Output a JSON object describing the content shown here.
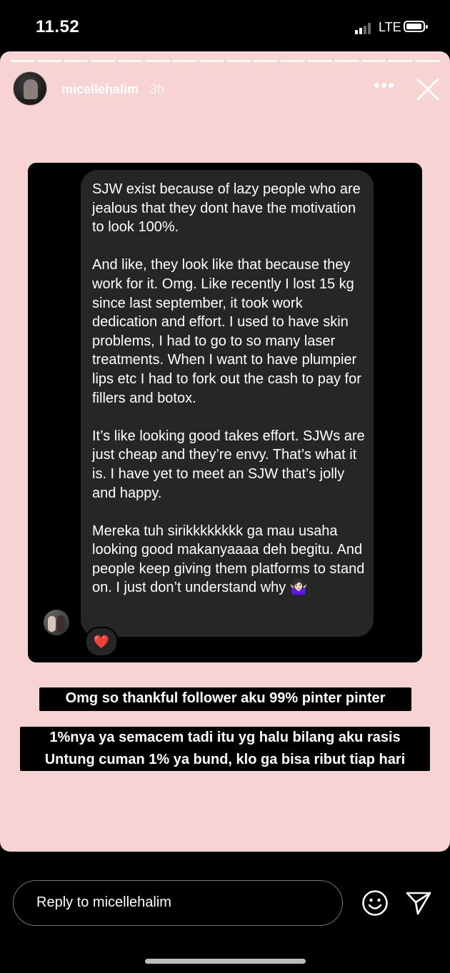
{
  "status_bar": {
    "time": "11.52",
    "network": "LTE"
  },
  "story": {
    "background_color": "#f7d3d4",
    "segments": 16,
    "username": "micellehalim",
    "time_ago": "3h",
    "more_icon": "ellipsis-icon",
    "close_icon": "close-icon"
  },
  "dm_screenshot": {
    "message": "SJW exist because of lazy people who are jealous that they dont have the motivation to look 100%.\n\nAnd like, they look like that because they work for it. Omg. Like recently I lost 15 kg since last september, it took work dedication and effort. I used to have skin problems, I had to go to so many laser treatments. When I want to have plumpier lips etc I had to fork out the cash to pay for fillers and botox.\n\nIt’s like looking good takes effort. SJWs are just cheap and they’re envy. That’s what it is. I have yet to meet an SJW that’s jolly and happy.\n\nMereka tuh sirikkkkkkkk ga mau usaha looking good makanyaaaa deh begitu. And people keep giving them platforms to stand on. I just don’t understand why 🤷🏻‍♀️",
    "reaction": "❤️"
  },
  "captions": [
    "Omg so thankful follower aku 99% pinter pinter",
    "1%nya ya semacem tadi itu yg halu bilang aku rasis\nUntung cuman 1% ya bund, klo ga bisa ribut tiap hari"
  ],
  "reply": {
    "placeholder": "Reply to micellehalim",
    "emoji_icon": "emoji-icon",
    "send_icon": "send-icon"
  }
}
